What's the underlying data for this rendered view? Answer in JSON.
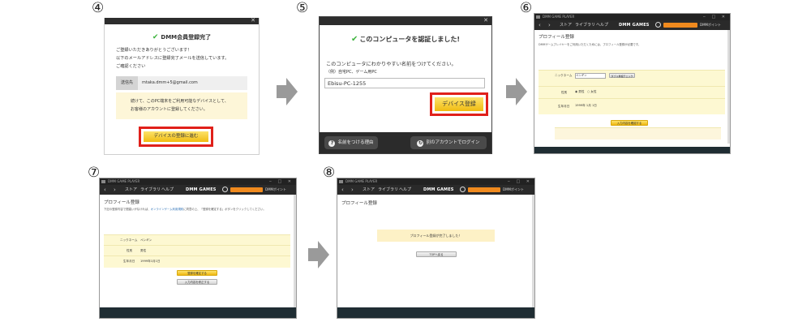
{
  "steps": {
    "s4": "④",
    "s5": "⑤",
    "s6": "⑥",
    "s7": "⑦",
    "s8": "⑧"
  },
  "colors": {
    "accent_red": "#e0201a",
    "button_yellow": "#f0bb11",
    "check_green": "#3db33d",
    "highlight_yellow": "#fdf8d2"
  },
  "panel4": {
    "title": "DMM会員登録完了",
    "message": [
      "ご登録いただきありがとうございます！",
      "以下のメールアドレスに登録完了メールを送信しています。",
      "ご確認ください"
    ],
    "email_label": "送信先",
    "email_value": "mtaka.dmm+5@gmail.com",
    "note": [
      "続けて、このPC端末をご利用可能なデバイスとして、",
      "お客様のアカウントに登録してください。"
    ],
    "button": "デバイスの登録に進む"
  },
  "panel5": {
    "title": "このコンピュータを認証しました!",
    "message": "このコンピュータにわかりやすい名前をつけてください。",
    "example": "（例）自宅PC、ゲーム用PC",
    "input_value": "Ebisu-PC-1255",
    "button": "デバイス登録",
    "footer_left": "名前をつける理由",
    "footer_right": "別のアカウントでログイン"
  },
  "player": {
    "app_title": "DMM GAME PLAYER",
    "menu_store": "ストア",
    "menu_library": "ライブラリ",
    "menu_help": "ヘルプ",
    "logo": "DMM GAMES",
    "points": "DMMポイント"
  },
  "panel6": {
    "heading": "プロフィール登録",
    "sub": "DMMゲームプレイヤーをご利用いただくためには、プロフィール登録が必要です。",
    "nickname_label": "ニックネーム",
    "nickname_value": "ペンギン",
    "nickname_check": "ダブル重複チェック",
    "gender_label": "性別",
    "gender_male": "男性",
    "gender_female": "女性",
    "birthday_label": "生年月日",
    "birthday_year": "1999",
    "birthday_month": "1",
    "birthday_day": "1",
    "confirm_button": "入力内容を確認する"
  },
  "panel7": {
    "heading": "プロフィール登録",
    "sub_before": "下記の登録内容で間違いがなければ、",
    "sub_link": "オンラインゲーム利用規約",
    "sub_after": "に同意の上、「登録を確定する」ボタンをクリックしてください。",
    "nickname_label": "ニックネーム",
    "nickname_value": "ペンギン",
    "gender_label": "性別",
    "gender_value": "男性",
    "birthday_label": "生年月日",
    "birthday_value": "1999年1月1日",
    "confirm_button": "登録を確定する",
    "fix_button": "入力内容を修正する"
  },
  "panel8": {
    "heading": "プロフィール登録",
    "complete": "プロフィール登録が完了しました！",
    "top_button": "TOPへ戻る"
  }
}
